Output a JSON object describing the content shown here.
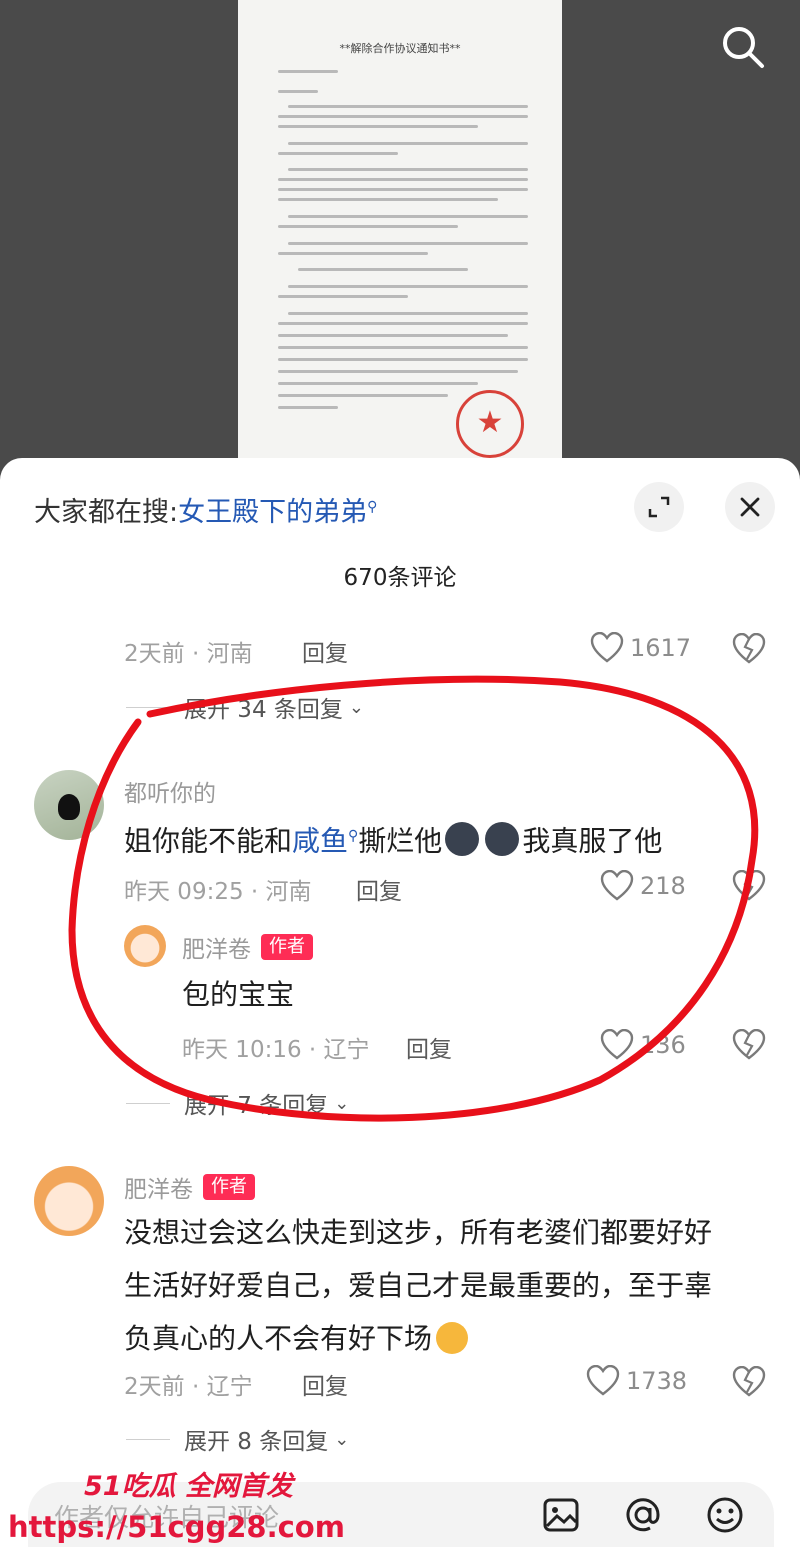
{
  "document_image": {
    "title": "**解除合作协议通知书**"
  },
  "hot_search": {
    "prefix": "大家都在搜:",
    "keyword": "女王殿下的弟弟"
  },
  "comments_header": {
    "count_title": "670条评论"
  },
  "prev_comment": {
    "meta": "2天前 · 河南",
    "reply_label": "回复",
    "likes": "1617",
    "expand_label": "展开 34 条回复"
  },
  "comment_2": {
    "username": "都听你的",
    "text_part1": "姐你能不能和",
    "link_text": "咸鱼",
    "text_part2": "撕烂他",
    "text_part3": "我真服了他",
    "meta": "昨天 09:25 · 河南",
    "reply_label": "回复",
    "likes": "218"
  },
  "reply_2_1": {
    "username": "肥洋卷",
    "author_tag": "作者",
    "text": "包的宝宝",
    "meta": "昨天 10:16 · 辽宁",
    "reply_label": "回复",
    "likes": "136",
    "expand_label": "展开 7 条回复"
  },
  "comment_3": {
    "username": "肥洋卷",
    "author_tag": "作者",
    "line1": "没想过会这么快走到这步，所有老婆们都要好好",
    "line2": "生活好好爱自己，爱自己才是最重要的，至于辜",
    "line3": "负真心的人不会有好下场",
    "meta": "2天前 · 辽宁",
    "reply_label": "回复",
    "likes": "1738",
    "expand_label": "展开 8 条回复"
  },
  "input_bar": {
    "placeholder": "作者仅允许自己评论"
  },
  "watermark": {
    "line1": "51吃瓜 全网首发",
    "line2": "https://51cgg28.com"
  },
  "colors": {
    "accent_link": "#2559b4",
    "author_tag": "#fe2c55",
    "annotation_ring": "#e8101a"
  }
}
